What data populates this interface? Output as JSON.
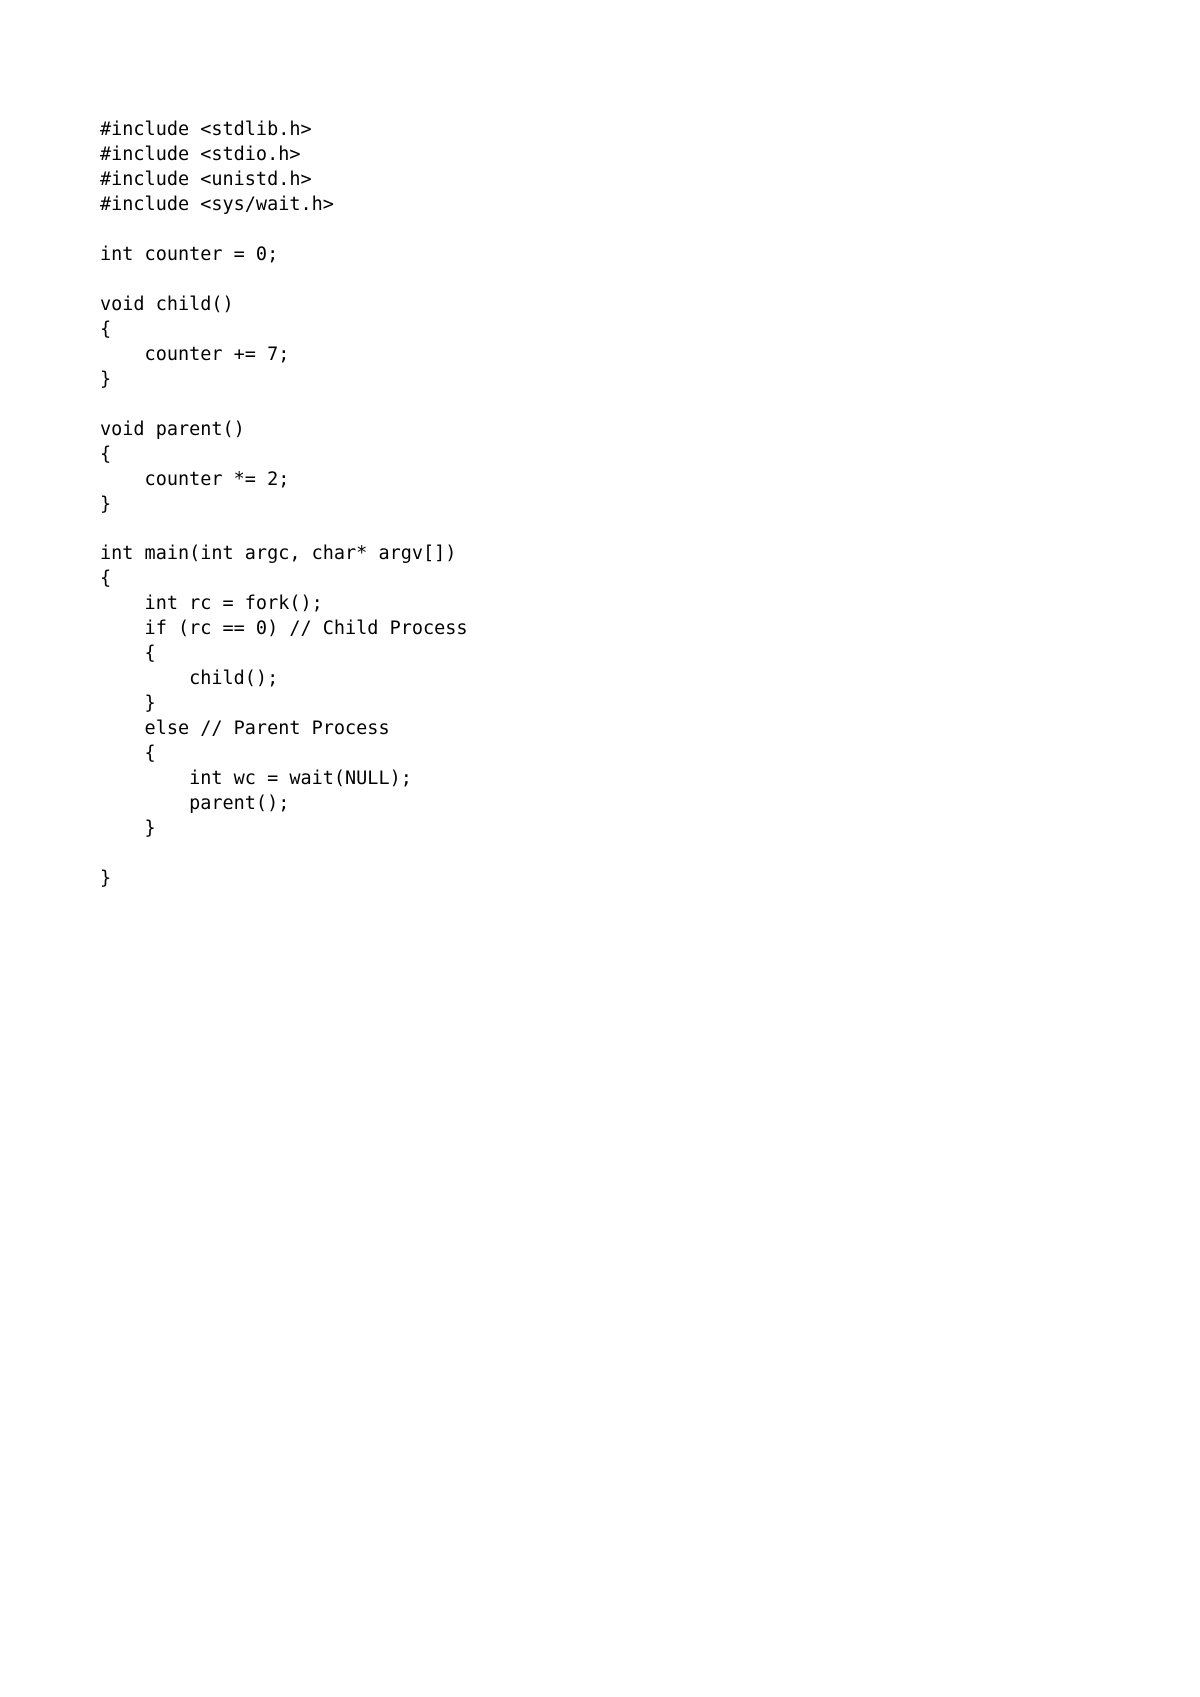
{
  "code": {
    "lines": [
      "#include <stdlib.h>",
      "#include <stdio.h>",
      "#include <unistd.h>",
      "#include <sys/wait.h>",
      "",
      "int counter = 0;",
      "",
      "void child()",
      "{",
      "    counter += 7;",
      "}",
      "",
      "void parent()",
      "{",
      "    counter *= 2;",
      "}",
      "",
      "int main(int argc, char* argv[])",
      "{",
      "    int rc = fork();",
      "    if (rc == 0) // Child Process",
      "    {",
      "        child();",
      "    }",
      "    else // Parent Process",
      "    {",
      "        int wc = wait(NULL);",
      "        parent();",
      "    }",
      "",
      "}"
    ]
  }
}
